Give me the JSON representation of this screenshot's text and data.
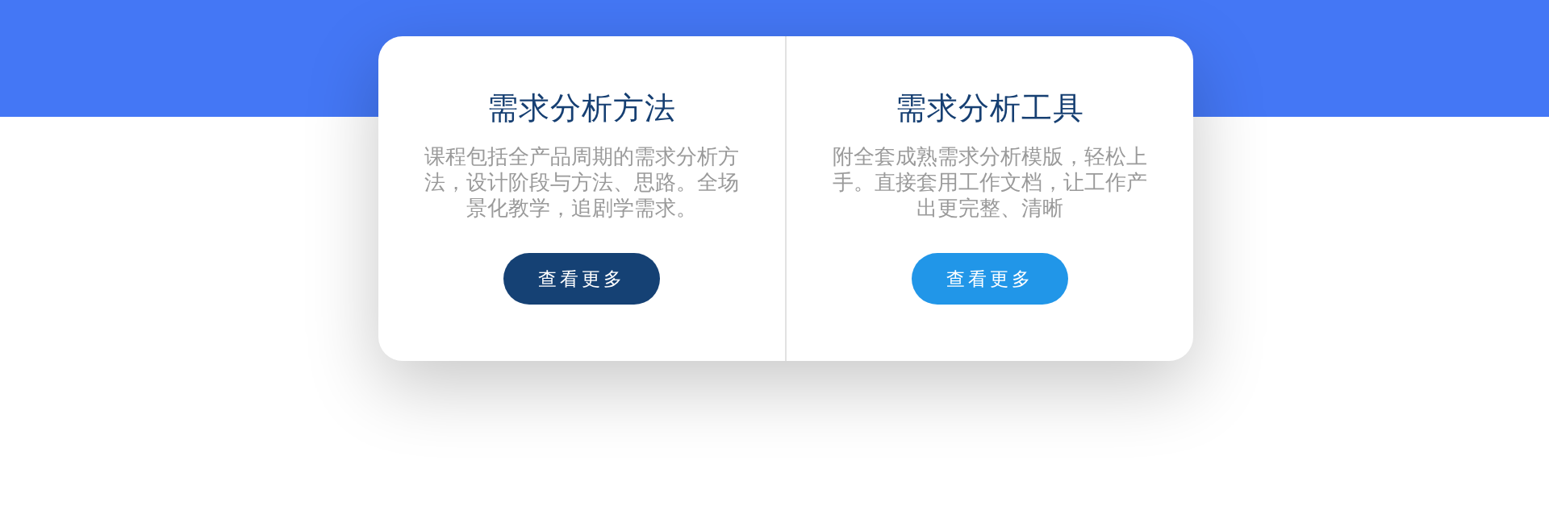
{
  "cards": [
    {
      "title": "需求分析方法",
      "description": "课程包括全产品周期的需求分析方法，设计阶段与方法、思路。全场景化教学，追剧学需求。",
      "button": {
        "label": "查看更多",
        "kind": "dark"
      }
    },
    {
      "title": "需求分析工具",
      "description": "附全套成熟需求分析模版，轻松上手。直接套用工作文档，让工作产出更完整、清晰",
      "button": {
        "label": "查看更多",
        "kind": "bright"
      }
    }
  ]
}
